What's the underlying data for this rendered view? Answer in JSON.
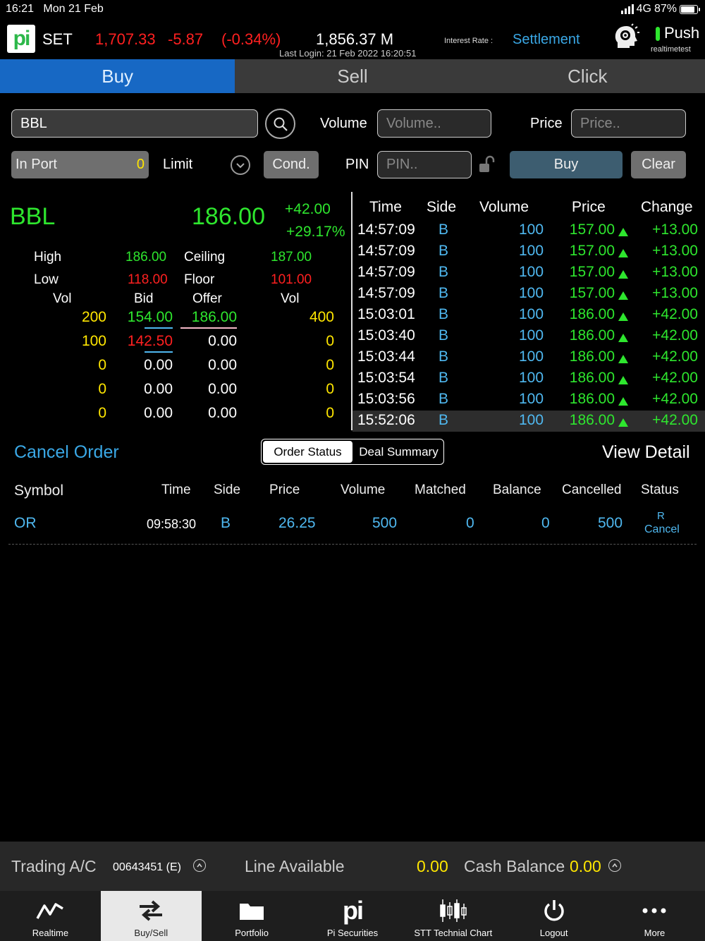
{
  "status_bar": {
    "time": "16:21",
    "date": "Mon 21 Feb",
    "network": "4G",
    "battery": "87%",
    "battery_level": 0.87
  },
  "header": {
    "market": "SET",
    "index": "1,707.33",
    "change": "-5.87",
    "change_pct": "(-0.34%)",
    "value": "1,856.37 M",
    "last_login": "Last Login: 21 Feb 2022 16:20:51",
    "interest_rate_label": "Interest Rate :",
    "settlement": "Settlement",
    "push": "Push",
    "user": "realtimetest"
  },
  "tabs": [
    {
      "label": "Buy"
    },
    {
      "label": "Sell"
    },
    {
      "label": "Click"
    }
  ],
  "form": {
    "symbol_value": "BBL",
    "volume_label": "Volume",
    "volume_placeholder": "Volume..",
    "price_label": "Price",
    "price_placeholder": "Price..",
    "inport_label": "In Port",
    "inport_value": "0",
    "limit_label": "Limit",
    "cond_label": "Cond.",
    "pin_label": "PIN",
    "pin_placeholder": "PIN..",
    "buy_label": "Buy",
    "clear_label": "Clear"
  },
  "quote": {
    "symbol": "BBL",
    "last": "186.00",
    "change": "+42.00",
    "change_pct": "+29.17%",
    "high_label": "High",
    "high": "186.00",
    "ceiling_label": "Ceiling",
    "ceiling": "187.00",
    "low_label": "Low",
    "low": "118.00",
    "floor_label": "Floor",
    "floor": "101.00",
    "col_vol": "Vol",
    "col_bid": "Bid",
    "col_offer": "Offer",
    "col_vol2": "Vol",
    "depth": [
      {
        "bid_vol": "200",
        "bid": "154.00",
        "offer": "186.00",
        "offer_vol": "400"
      },
      {
        "bid_vol": "100",
        "bid": "142.50",
        "offer": "0.00",
        "offer_vol": "0"
      },
      {
        "bid_vol": "0",
        "bid": "0.00",
        "offer": "0.00",
        "offer_vol": "0"
      },
      {
        "bid_vol": "0",
        "bid": "0.00",
        "offer": "0.00",
        "offer_vol": "0"
      },
      {
        "bid_vol": "0",
        "bid": "0.00",
        "offer": "0.00",
        "offer_vol": "0"
      }
    ]
  },
  "ticker": {
    "headers": {
      "time": "Time",
      "side": "Side",
      "volume": "Volume",
      "price": "Price",
      "change": "Change"
    },
    "rows": [
      {
        "time": "14:57:09",
        "side": "B",
        "volume": "100",
        "price": "157.00",
        "change": "+13.00"
      },
      {
        "time": "14:57:09",
        "side": "B",
        "volume": "100",
        "price": "157.00",
        "change": "+13.00"
      },
      {
        "time": "14:57:09",
        "side": "B",
        "volume": "100",
        "price": "157.00",
        "change": "+13.00"
      },
      {
        "time": "14:57:09",
        "side": "B",
        "volume": "100",
        "price": "157.00",
        "change": "+13.00"
      },
      {
        "time": "15:03:01",
        "side": "B",
        "volume": "100",
        "price": "186.00",
        "change": "+42.00"
      },
      {
        "time": "15:03:40",
        "side": "B",
        "volume": "100",
        "price": "186.00",
        "change": "+42.00"
      },
      {
        "time": "15:03:44",
        "side": "B",
        "volume": "100",
        "price": "186.00",
        "change": "+42.00"
      },
      {
        "time": "15:03:54",
        "side": "B",
        "volume": "100",
        "price": "186.00",
        "change": "+42.00"
      },
      {
        "time": "15:03:56",
        "side": "B",
        "volume": "100",
        "price": "186.00",
        "change": "+42.00"
      },
      {
        "time": "15:52:06",
        "side": "B",
        "volume": "100",
        "price": "186.00",
        "change": "+42.00"
      }
    ]
  },
  "orders": {
    "cancel_order": "Cancel Order",
    "seg_order_status": "Order Status",
    "seg_deal_summary": "Deal Summary",
    "view_detail": "View Detail",
    "headers": {
      "symbol": "Symbol",
      "time": "Time",
      "side": "Side",
      "price": "Price",
      "volume": "Volume",
      "matched": "Matched",
      "balance": "Balance",
      "cancelled": "Cancelled",
      "status": "Status"
    },
    "rows": [
      {
        "symbol": "OR",
        "time": "09:58:30",
        "side": "B",
        "price": "26.25",
        "volume": "500",
        "matched": "0",
        "balance": "0",
        "cancelled": "500",
        "status_code": "R",
        "status_text": "Cancel"
      }
    ]
  },
  "account": {
    "trading_label": "Trading A/C",
    "account_no": "00643451 (E)",
    "line_label": "Line Available",
    "line_value": "0.00",
    "cash_label": "Cash Balance",
    "cash_value": "0.00"
  },
  "nav": [
    {
      "label": "Realtime",
      "icon": "realtime-chart-icon"
    },
    {
      "label": "Buy/Sell",
      "icon": "buy-sell-arrows-icon"
    },
    {
      "label": "Portfolio",
      "icon": "folder-icon"
    },
    {
      "label": "Pi Securities",
      "icon": "pi-logo-icon"
    },
    {
      "label": "STT Technial Chart",
      "icon": "candlestick-icon"
    },
    {
      "label": "Logout",
      "icon": "power-icon"
    },
    {
      "label": "More",
      "icon": "more-dots-icon"
    }
  ],
  "colors": {
    "up": "#2ee62e",
    "down": "#ff2020",
    "accent": "#1768c4",
    "highlight": "#4fb8f0",
    "volume": "#ffe600"
  }
}
